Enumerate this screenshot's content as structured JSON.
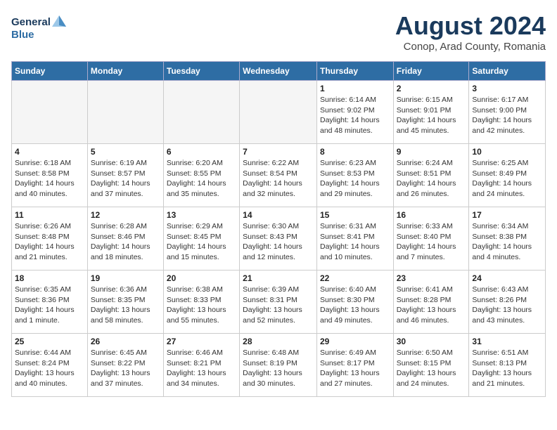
{
  "header": {
    "logo_line1": "General",
    "logo_line2": "Blue",
    "month_year": "August 2024",
    "location": "Conop, Arad County, Romania"
  },
  "days_of_week": [
    "Sunday",
    "Monday",
    "Tuesday",
    "Wednesday",
    "Thursday",
    "Friday",
    "Saturday"
  ],
  "weeks": [
    [
      {
        "day": "",
        "info": ""
      },
      {
        "day": "",
        "info": ""
      },
      {
        "day": "",
        "info": ""
      },
      {
        "day": "",
        "info": ""
      },
      {
        "day": "1",
        "info": "Sunrise: 6:14 AM\nSunset: 9:02 PM\nDaylight: 14 hours\nand 48 minutes."
      },
      {
        "day": "2",
        "info": "Sunrise: 6:15 AM\nSunset: 9:01 PM\nDaylight: 14 hours\nand 45 minutes."
      },
      {
        "day": "3",
        "info": "Sunrise: 6:17 AM\nSunset: 9:00 PM\nDaylight: 14 hours\nand 42 minutes."
      }
    ],
    [
      {
        "day": "4",
        "info": "Sunrise: 6:18 AM\nSunset: 8:58 PM\nDaylight: 14 hours\nand 40 minutes."
      },
      {
        "day": "5",
        "info": "Sunrise: 6:19 AM\nSunset: 8:57 PM\nDaylight: 14 hours\nand 37 minutes."
      },
      {
        "day": "6",
        "info": "Sunrise: 6:20 AM\nSunset: 8:55 PM\nDaylight: 14 hours\nand 35 minutes."
      },
      {
        "day": "7",
        "info": "Sunrise: 6:22 AM\nSunset: 8:54 PM\nDaylight: 14 hours\nand 32 minutes."
      },
      {
        "day": "8",
        "info": "Sunrise: 6:23 AM\nSunset: 8:53 PM\nDaylight: 14 hours\nand 29 minutes."
      },
      {
        "day": "9",
        "info": "Sunrise: 6:24 AM\nSunset: 8:51 PM\nDaylight: 14 hours\nand 26 minutes."
      },
      {
        "day": "10",
        "info": "Sunrise: 6:25 AM\nSunset: 8:49 PM\nDaylight: 14 hours\nand 24 minutes."
      }
    ],
    [
      {
        "day": "11",
        "info": "Sunrise: 6:26 AM\nSunset: 8:48 PM\nDaylight: 14 hours\nand 21 minutes."
      },
      {
        "day": "12",
        "info": "Sunrise: 6:28 AM\nSunset: 8:46 PM\nDaylight: 14 hours\nand 18 minutes."
      },
      {
        "day": "13",
        "info": "Sunrise: 6:29 AM\nSunset: 8:45 PM\nDaylight: 14 hours\nand 15 minutes."
      },
      {
        "day": "14",
        "info": "Sunrise: 6:30 AM\nSunset: 8:43 PM\nDaylight: 14 hours\nand 12 minutes."
      },
      {
        "day": "15",
        "info": "Sunrise: 6:31 AM\nSunset: 8:41 PM\nDaylight: 14 hours\nand 10 minutes."
      },
      {
        "day": "16",
        "info": "Sunrise: 6:33 AM\nSunset: 8:40 PM\nDaylight: 14 hours\nand 7 minutes."
      },
      {
        "day": "17",
        "info": "Sunrise: 6:34 AM\nSunset: 8:38 PM\nDaylight: 14 hours\nand 4 minutes."
      }
    ],
    [
      {
        "day": "18",
        "info": "Sunrise: 6:35 AM\nSunset: 8:36 PM\nDaylight: 14 hours\nand 1 minute."
      },
      {
        "day": "19",
        "info": "Sunrise: 6:36 AM\nSunset: 8:35 PM\nDaylight: 13 hours\nand 58 minutes."
      },
      {
        "day": "20",
        "info": "Sunrise: 6:38 AM\nSunset: 8:33 PM\nDaylight: 13 hours\nand 55 minutes."
      },
      {
        "day": "21",
        "info": "Sunrise: 6:39 AM\nSunset: 8:31 PM\nDaylight: 13 hours\nand 52 minutes."
      },
      {
        "day": "22",
        "info": "Sunrise: 6:40 AM\nSunset: 8:30 PM\nDaylight: 13 hours\nand 49 minutes."
      },
      {
        "day": "23",
        "info": "Sunrise: 6:41 AM\nSunset: 8:28 PM\nDaylight: 13 hours\nand 46 minutes."
      },
      {
        "day": "24",
        "info": "Sunrise: 6:43 AM\nSunset: 8:26 PM\nDaylight: 13 hours\nand 43 minutes."
      }
    ],
    [
      {
        "day": "25",
        "info": "Sunrise: 6:44 AM\nSunset: 8:24 PM\nDaylight: 13 hours\nand 40 minutes."
      },
      {
        "day": "26",
        "info": "Sunrise: 6:45 AM\nSunset: 8:22 PM\nDaylight: 13 hours\nand 37 minutes."
      },
      {
        "day": "27",
        "info": "Sunrise: 6:46 AM\nSunset: 8:21 PM\nDaylight: 13 hours\nand 34 minutes."
      },
      {
        "day": "28",
        "info": "Sunrise: 6:48 AM\nSunset: 8:19 PM\nDaylight: 13 hours\nand 30 minutes."
      },
      {
        "day": "29",
        "info": "Sunrise: 6:49 AM\nSunset: 8:17 PM\nDaylight: 13 hours\nand 27 minutes."
      },
      {
        "day": "30",
        "info": "Sunrise: 6:50 AM\nSunset: 8:15 PM\nDaylight: 13 hours\nand 24 minutes."
      },
      {
        "day": "31",
        "info": "Sunrise: 6:51 AM\nSunset: 8:13 PM\nDaylight: 13 hours\nand 21 minutes."
      }
    ]
  ]
}
